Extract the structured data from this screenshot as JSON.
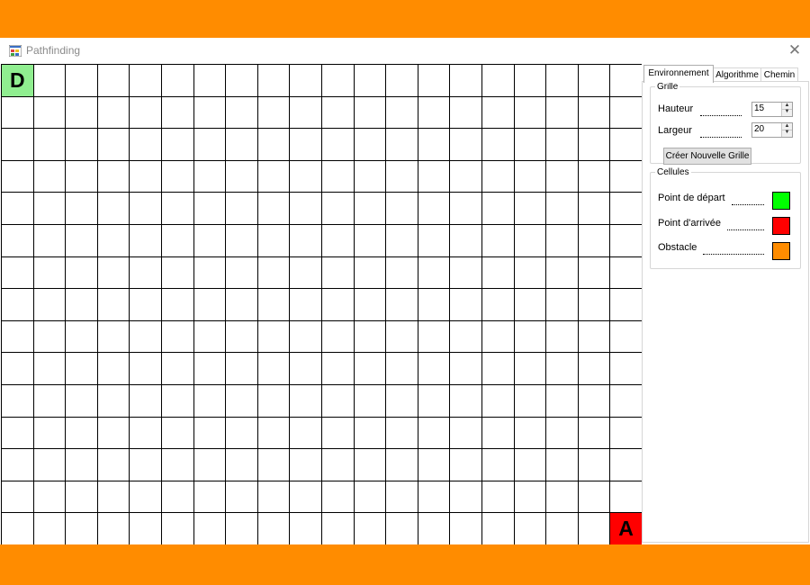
{
  "window": {
    "title": "Pathfinding",
    "close_glyph": "✕",
    "background": "#ff8c00"
  },
  "grid": {
    "rows": 15,
    "cols": 20,
    "start": {
      "row": 0,
      "col": 0,
      "label": "D",
      "color": "#90ee90"
    },
    "end": {
      "row": 14,
      "col": 19,
      "label": "A",
      "color": "#ff0000"
    }
  },
  "tabs": [
    {
      "label": "Environnement",
      "active": true
    },
    {
      "label": "Algorithme",
      "active": false
    },
    {
      "label": "Chemin",
      "active": false
    }
  ],
  "grille": {
    "legend": "Grille",
    "hauteur_label": "Hauteur",
    "hauteur_value": "15",
    "largeur_label": "Largeur",
    "largeur_value": "20",
    "create_button": "Créer Nouvelle Grille"
  },
  "cellules": {
    "legend": "Cellules",
    "items": [
      {
        "label": "Point de départ",
        "color": "#00ff00"
      },
      {
        "label": "Point d'arrivée",
        "color": "#ff0000"
      },
      {
        "label": "Obstacle",
        "color": "#ff8c00"
      }
    ]
  }
}
